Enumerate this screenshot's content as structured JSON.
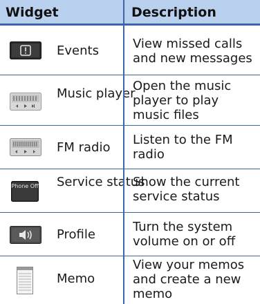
{
  "table": {
    "headers": {
      "widget": "Widget",
      "description": "Description"
    },
    "rows": [
      {
        "icon": "events-icon",
        "widget": "Events",
        "description": "View missed calls and new messages"
      },
      {
        "icon": "music-player-icon",
        "widget": "Music player",
        "description": "Open the music player to play music files"
      },
      {
        "icon": "fm-radio-icon",
        "widget": "FM radio",
        "description": "Listen to the FM radio"
      },
      {
        "icon": "service-status-icon",
        "icon_text": "Phone Off",
        "widget": "Service status",
        "description": "Show the current service status"
      },
      {
        "icon": "profile-icon",
        "widget": "Profile",
        "description": "Turn the system volume on or off"
      },
      {
        "icon": "memo-icon",
        "widget": "Memo",
        "description": "View your memos and create a new memo"
      }
    ]
  }
}
